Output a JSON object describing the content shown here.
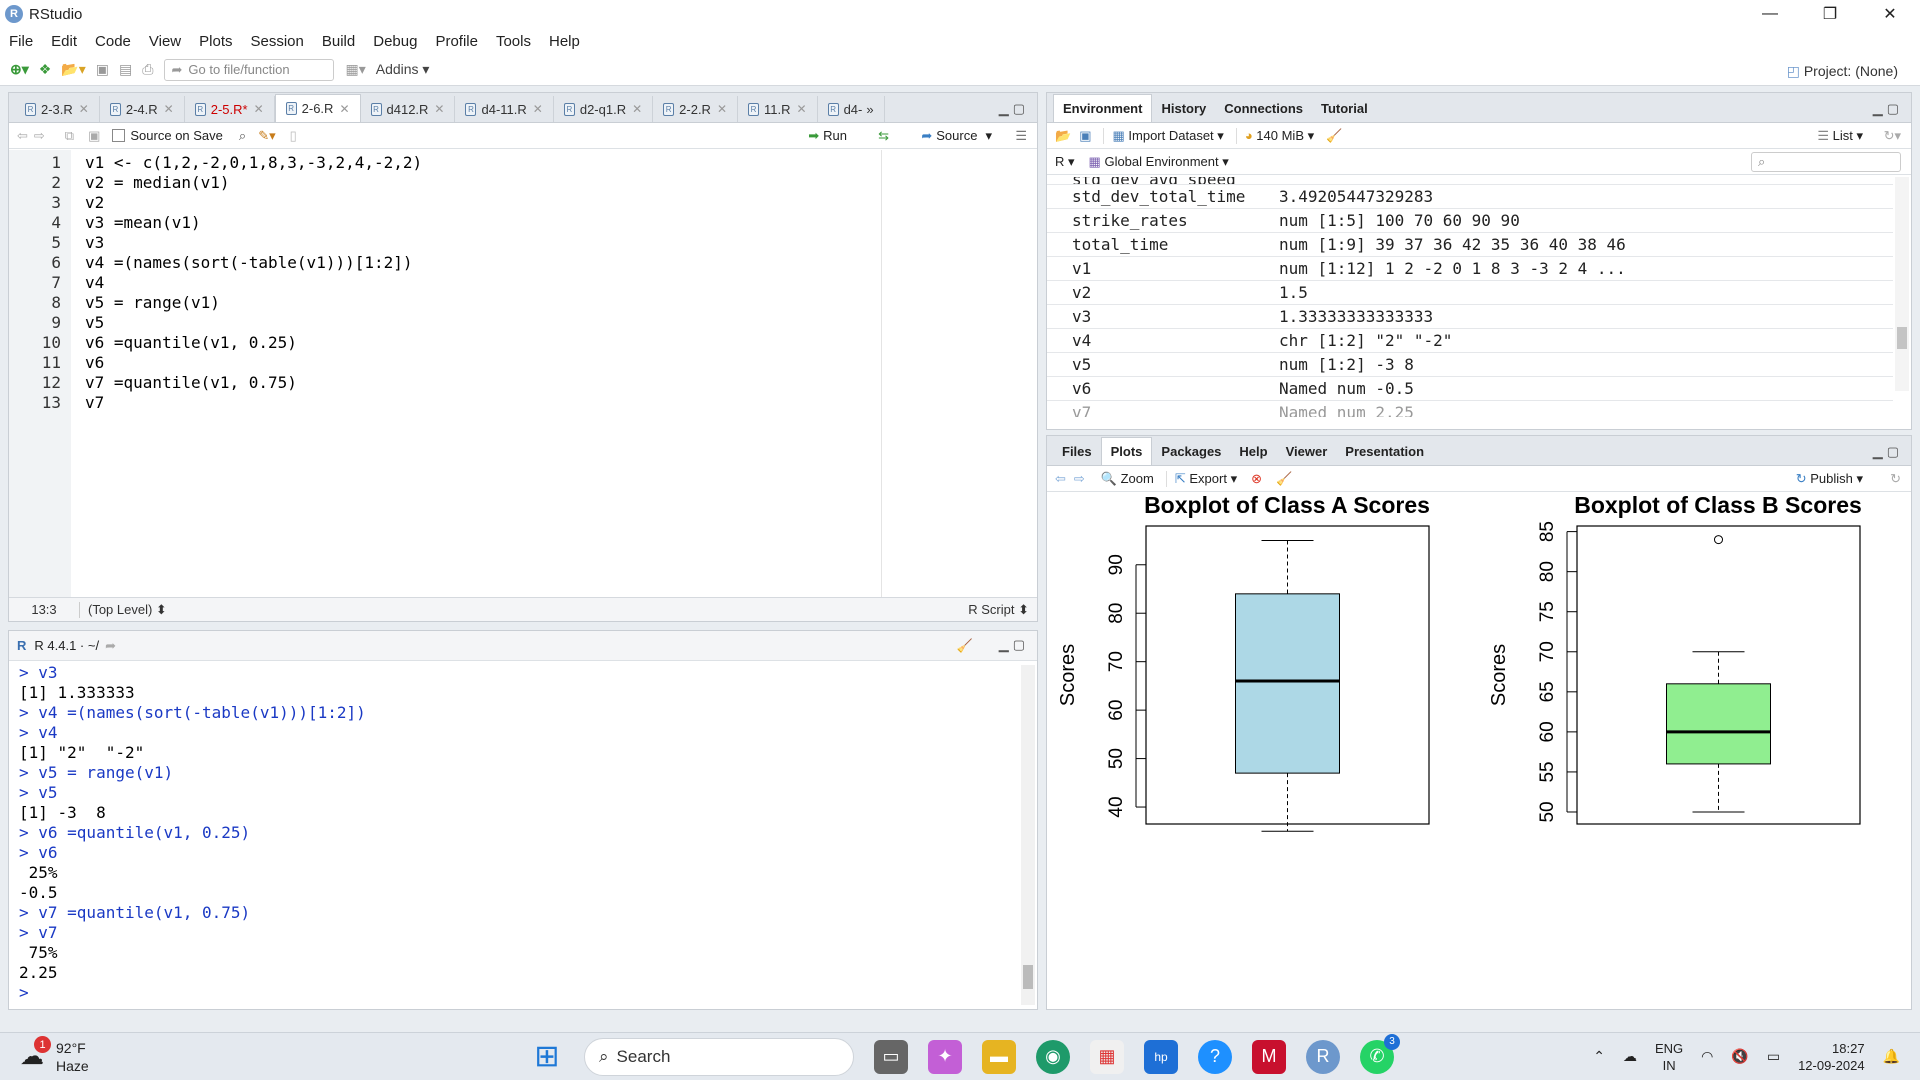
{
  "window": {
    "app_title": "RStudio",
    "min": "—",
    "max": "❐",
    "close": "✕"
  },
  "menu": [
    "File",
    "Edit",
    "Code",
    "View",
    "Plots",
    "Session",
    "Build",
    "Debug",
    "Profile",
    "Tools",
    "Help"
  ],
  "toolbar": {
    "goto_placeholder": "Go to file/function",
    "addins": "Addins",
    "project": "Project: (None)"
  },
  "editor": {
    "tabs": [
      {
        "label": "2-3.R",
        "active": false,
        "modified": false
      },
      {
        "label": "2-4.R",
        "active": false,
        "modified": false
      },
      {
        "label": "2-5.R*",
        "active": false,
        "modified": true
      },
      {
        "label": "2-6.R",
        "active": true,
        "modified": false
      },
      {
        "label": "d412.R",
        "active": false,
        "modified": false
      },
      {
        "label": "d4-11.R",
        "active": false,
        "modified": false
      },
      {
        "label": "d2-q1.R",
        "active": false,
        "modified": false
      },
      {
        "label": "2-2.R",
        "active": false,
        "modified": false
      },
      {
        "label": "11.R",
        "active": false,
        "modified": false
      },
      {
        "label": "d4-",
        "active": false,
        "modified": false
      }
    ],
    "source_on_save": "Source on Save",
    "run": "Run",
    "source": "Source",
    "lines": [
      "v1 <- c(1,2,-2,0,1,8,3,-3,2,4,-2,2)",
      "v2 = median(v1)",
      "v2",
      "",
      "v3 =mean(v1)",
      "v3",
      "v4 =(names(sort(-table(v1)))[1:2])",
      "v4",
      "v5 = range(v1)",
      "v5",
      "v6 =quantile(v1, 0.25)",
      "v6",
      "v7 =quantile(v1, 0.75)",
      "v7"
    ],
    "line_numbers": [
      "1",
      "2",
      "3",
      "4",
      "5",
      "6",
      "7",
      "8",
      "9",
      "10",
      "11",
      "12",
      "13"
    ],
    "status_pos": "13:3",
    "status_scope": "(Top Level)",
    "status_type": "R Script"
  },
  "console": {
    "header": "R 4.4.1 · ~/",
    "lines": [
      {
        "t": "cmd",
        "v": "> v3"
      },
      {
        "t": "res",
        "v": "[1] 1.333333"
      },
      {
        "t": "cmd",
        "v": "> v4 =(names(sort(-table(v1)))[1:2])"
      },
      {
        "t": "cmd",
        "v": "> v4"
      },
      {
        "t": "res",
        "v": "[1] \"2\"  \"-2\""
      },
      {
        "t": "cmd",
        "v": "> v5 = range(v1)"
      },
      {
        "t": "cmd",
        "v": "> v5"
      },
      {
        "t": "res",
        "v": "[1] -3  8"
      },
      {
        "t": "cmd",
        "v": "> v6 =quantile(v1, 0.25)"
      },
      {
        "t": "cmd",
        "v": "> v6"
      },
      {
        "t": "res",
        "v": " 25% "
      },
      {
        "t": "res",
        "v": "-0.5 "
      },
      {
        "t": "cmd",
        "v": "> v7 =quantile(v1, 0.75)"
      },
      {
        "t": "cmd",
        "v": "> v7"
      },
      {
        "t": "res",
        "v": " 75% "
      },
      {
        "t": "res",
        "v": "2.25 "
      },
      {
        "t": "cmd",
        "v": "> "
      }
    ]
  },
  "env": {
    "tabs": [
      "Environment",
      "History",
      "Connections",
      "Tutorial"
    ],
    "import": "Import Dataset",
    "memory": "140 MiB",
    "view": "List",
    "lang": "R",
    "scope": "Global Environment",
    "partial_top": "std_dev_avg_speed",
    "rows": [
      {
        "name": "std_dev_total_time",
        "value": "3.49205447329283"
      },
      {
        "name": "strike_rates",
        "value": "num [1:5] 100 70 60 90 90"
      },
      {
        "name": "total_time",
        "value": "num [1:9] 39 37 36 42 35 36 40 38 46"
      },
      {
        "name": "v1",
        "value": "num [1:12] 1 2 -2 0 1 8 3 -3 2 4 ..."
      },
      {
        "name": "v2",
        "value": "1.5"
      },
      {
        "name": "v3",
        "value": "1.33333333333333"
      },
      {
        "name": "v4",
        "value": "chr [1:2] \"2\" \"-2\""
      },
      {
        "name": "v5",
        "value": "num [1:2] -3 8"
      },
      {
        "name": "v6",
        "value": "Named num -0.5"
      },
      {
        "name": "v7",
        "value": "Named num 2.25"
      }
    ]
  },
  "plots": {
    "tabs": [
      "Files",
      "Plots",
      "Packages",
      "Help",
      "Viewer",
      "Presentation"
    ],
    "zoom": "Zoom",
    "export": "Export",
    "publish": "Publish"
  },
  "chart_data": [
    {
      "type": "boxplot",
      "title": "Boxplot of Class A Scores",
      "ylabel": "Scores",
      "ylim": [
        36.5,
        98
      ],
      "ticks": [
        40,
        50,
        60,
        70,
        80,
        90
      ],
      "whisker_low": 35,
      "q1": 47,
      "median": 66,
      "q3": 84,
      "whisker_high": 95,
      "outliers": [],
      "fill": "#add8e6"
    },
    {
      "type": "boxplot",
      "title": "Boxplot of Class B Scores",
      "ylabel": "Scores",
      "ylim": [
        48.5,
        85.7
      ],
      "ticks": [
        50,
        55,
        60,
        65,
        70,
        75,
        80,
        85
      ],
      "whisker_low": 50,
      "q1": 56,
      "median": 60,
      "q3": 66,
      "whisker_high": 70,
      "outliers": [
        84
      ],
      "fill": "#90ee90"
    }
  ],
  "taskbar": {
    "weather_temp": "92°F",
    "weather_desc": "Haze",
    "weather_badge": "1",
    "search": "Search",
    "lang1": "ENG",
    "lang2": "IN",
    "time": "18:27",
    "date": "12-09-2024",
    "whatsapp_badge": "3"
  }
}
